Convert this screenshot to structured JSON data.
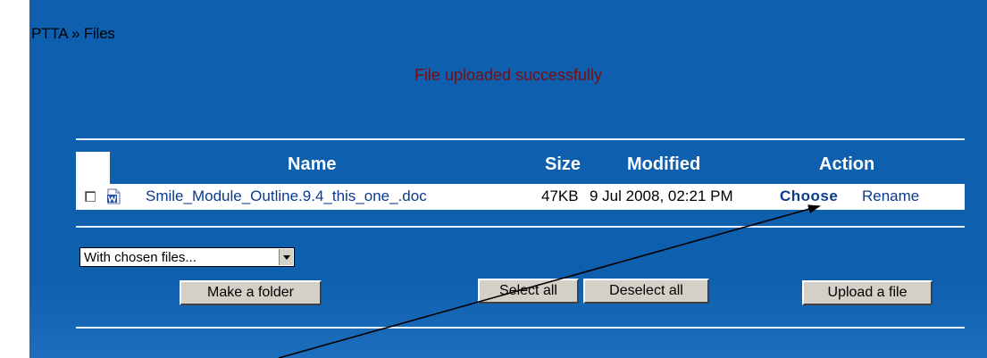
{
  "breadcrumb": "PTTA » Files",
  "notice": "File uploaded successfully",
  "table": {
    "headers": {
      "name": "Name",
      "size": "Size",
      "modified": "Modified",
      "action": "Action"
    },
    "rows": [
      {
        "name": "Smile_Module_Outline.9.4_this_one_.doc",
        "size": "47KB",
        "modified": "9 Jul 2008, 02:21 PM",
        "actions": [
          "Choose",
          "Rename"
        ]
      }
    ]
  },
  "bulk_select": {
    "value": "With chosen files..."
  },
  "buttons": {
    "make_folder": "Make a folder",
    "select_all": "Select all",
    "deselect_all": "Deselect all",
    "upload_file": "Upload a file"
  },
  "colors": {
    "background": "#0e5fae",
    "notice_text": "#7a0e0e",
    "link": "#0b3a8e"
  },
  "icons": {
    "file_type": "word-doc-icon",
    "select_arrow": "chevron-down-icon"
  }
}
